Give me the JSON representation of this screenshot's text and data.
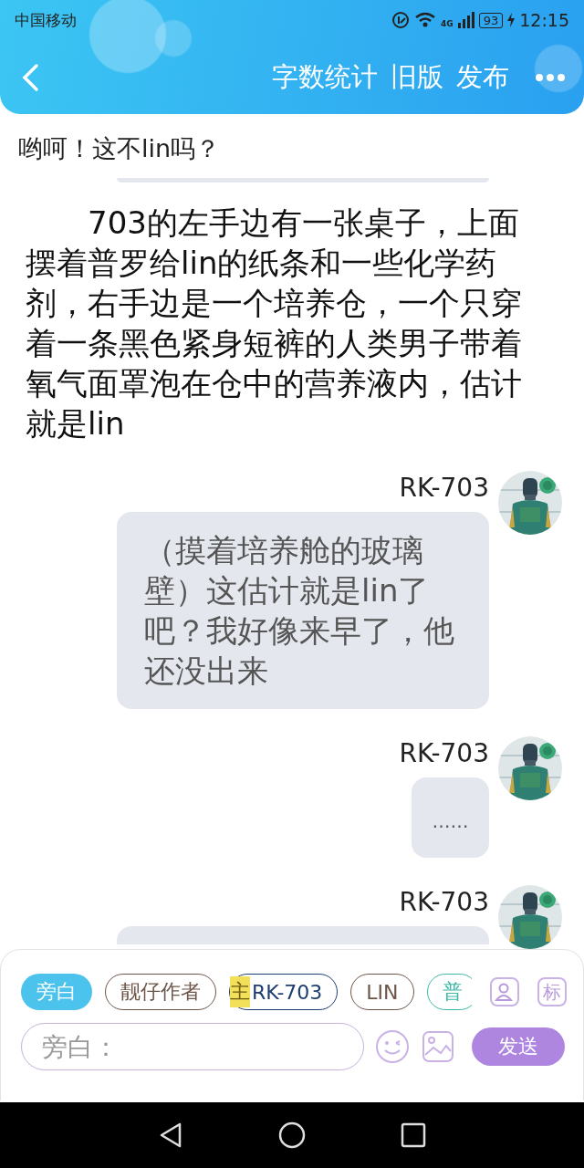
{
  "status_bar": {
    "carrier": "中国移动",
    "network": "4G",
    "battery": "93",
    "time": "12:15"
  },
  "header": {
    "actions": [
      "字数统计",
      "旧版",
      "发布"
    ]
  },
  "messages": [
    {
      "kind": "note",
      "text": "哟呵！这不lin吗？"
    },
    {
      "kind": "cut_bubble"
    },
    {
      "kind": "narration",
      "text": "703的左手边有一张桌子，上面摆着普罗给lin的纸条和一些化学药剂，右手边是一个培养仓，一个只穿着一条黑色紧身短裤的人类男子带着氧气面罩泡在仓中的营养液内，估计就是lin"
    },
    {
      "kind": "speech",
      "name": "RK-703",
      "text": "（摸着培养舱的玻璃壁）这估计就是lin了吧？我好像来早了，他还没出来"
    },
    {
      "kind": "speech",
      "name": "RK-703",
      "text": "……"
    },
    {
      "kind": "speech_cut",
      "name": "RK-703"
    }
  ],
  "roles": [
    {
      "label": "旁白",
      "selected": true,
      "color": "#4cc3ec"
    },
    {
      "label": "靓仔作者",
      "selected": false,
      "color": "#6d5548"
    },
    {
      "label": "RK-703",
      "selected": false,
      "color": "#1d3d72",
      "tag": "主"
    },
    {
      "label": "LIN",
      "selected": false,
      "color": "#6d5548"
    },
    {
      "label": "普",
      "selected": false,
      "color": "#3fb8a8"
    }
  ],
  "side_tools": [
    "标"
  ],
  "composer": {
    "placeholder": "旁白：",
    "send": "发送"
  }
}
